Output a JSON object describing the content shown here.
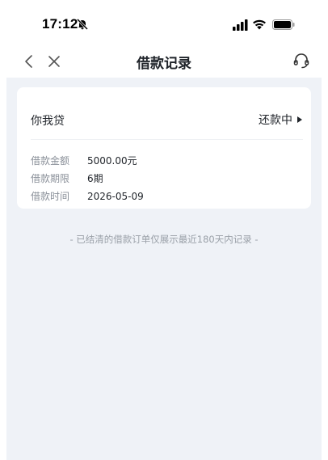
{
  "status_bar": {
    "time": "17:12",
    "icons": [
      "bell-off-icon",
      "signal-icon",
      "wifi-icon",
      "battery-icon"
    ]
  },
  "nav": {
    "title": "借款记录",
    "icons": [
      "back-icon",
      "close-icon",
      "headset-icon"
    ]
  },
  "loan_card": {
    "lender": "你我贷",
    "status": "还款中",
    "status_icon": "arrow-right-icon",
    "rows": [
      {
        "label": "借款金额",
        "value": "5000.00元"
      },
      {
        "label": "借款期限",
        "value": "6期"
      },
      {
        "label": "借款时间",
        "value": "2026-05-09"
      }
    ]
  },
  "footer": {
    "note": "- 已结清的借款订单仅展示最近180天内记录 -"
  },
  "colors": {
    "content_background": "#eff2f7",
    "card_background": "#ffffff",
    "label_gray": "#8a9099",
    "text_dark": "#1f2329"
  }
}
